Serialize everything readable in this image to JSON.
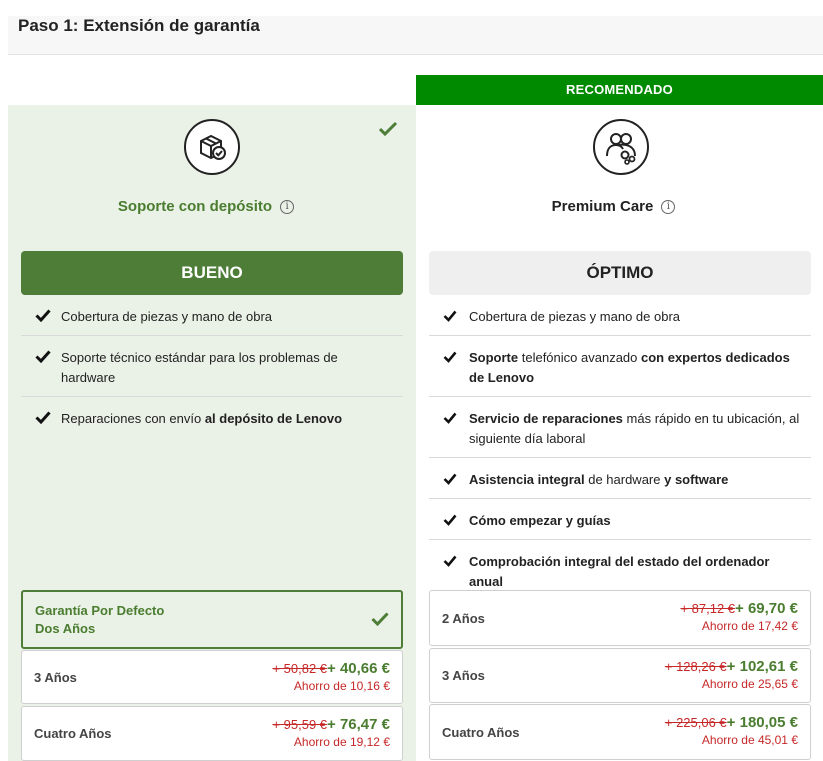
{
  "header": {
    "title": "Paso 1: Extensión de garantía"
  },
  "banner": {
    "label": "RECOMENDADO"
  },
  "plans": [
    {
      "name": "Soporte con depósito",
      "tier": "BUENO",
      "features": [
        {
          "plain": "Cobertura de piezas y mano de obra"
        },
        {
          "plain": "Soporte técnico estándar para los problemas de hardware"
        },
        {
          "pre": "Reparaciones con envío ",
          "bold": "al depósito de Lenovo"
        }
      ],
      "prices": [
        {
          "duration_line1": "Garantía Por Defecto",
          "duration_line2": "Dos Años"
        },
        {
          "duration": "3 Años",
          "old": "+ 50,82 €",
          "new": "+ 40,66 €",
          "saving": "Ahorro de 10,16 €"
        },
        {
          "duration": "Cuatro Años",
          "old": "+ 95,59 €",
          "new": "+ 76,47 €",
          "saving": "Ahorro de 19,12 €"
        }
      ]
    },
    {
      "name": "Premium Care",
      "tier": "ÓPTIMO",
      "features": [
        {
          "plain": "Cobertura de piezas y mano de obra"
        },
        {
          "b1": "Soporte",
          "t1": " telefónico avanzado ",
          "b2": "con expertos dedicados de Lenovo"
        },
        {
          "b1": "Servicio de reparaciones",
          "t1": " más rápido en tu ubicación, al siguiente día laboral"
        },
        {
          "b1": "Asistencia integral",
          "t1": " de hardware ",
          "b2": "y software"
        },
        {
          "b1": "Cómo empezar y guías"
        },
        {
          "b1": "Comprobación integral del estado del ordenador anual"
        }
      ],
      "prices": [
        {
          "duration": "2 Años",
          "old": "+ 87,12 €",
          "new": "+ 69,70 €",
          "saving": "Ahorro de 17,42 €"
        },
        {
          "duration": "3 Años",
          "old": "+ 128,26 €",
          "new": "+ 102,61 €",
          "saving": "Ahorro de 25,65 €"
        },
        {
          "duration": "Cuatro Años",
          "old": "+ 225,06 €",
          "new": "+ 180,05 €",
          "saving": "Ahorro de 45,01 €"
        }
      ]
    }
  ],
  "icons": {
    "info": "info-icon",
    "check": "check-icon",
    "depot": "package-shield-icon",
    "premium": "people-gears-icon"
  },
  "colors": {
    "accent_green": "#4e7d37",
    "banner_green": "#008a00",
    "saving_red": "#c62828",
    "selected_bg": "#eaf1e7"
  }
}
